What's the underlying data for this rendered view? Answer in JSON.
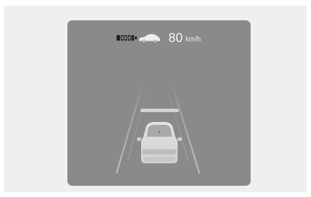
{
  "display": {
    "background": "#8a8a8a",
    "frame_background": "#efefef"
  },
  "status": {
    "distance_icon": "following-distance-icon",
    "lead_vehicle_icon": "lead-car-icon",
    "speed": "80",
    "unit": "km/h"
  },
  "scene": {
    "target_marker": "detected-vehicle-bar",
    "ego_vehicle": "ego-car-icon"
  }
}
